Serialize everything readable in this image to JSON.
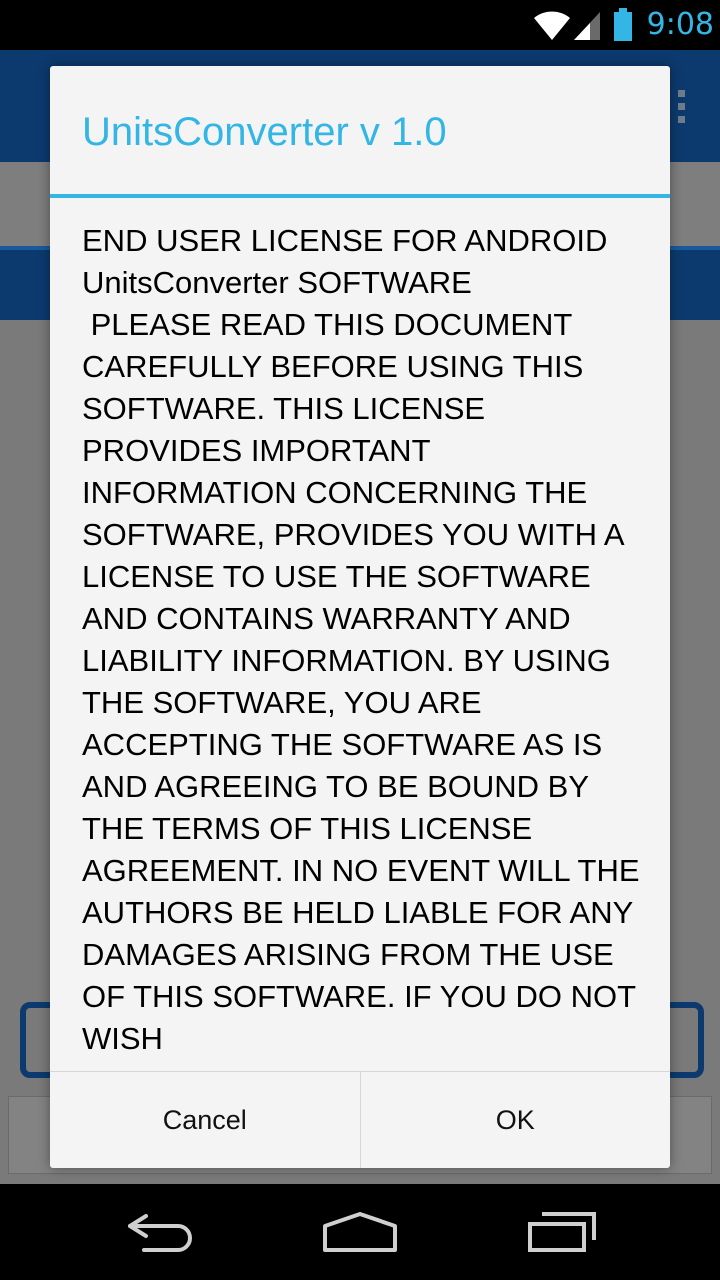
{
  "status_bar": {
    "time": "9:08",
    "icons": [
      "wifi-icon",
      "signal-icon",
      "battery-icon"
    ],
    "accent_color": "#33b5e5"
  },
  "dialog": {
    "title": "UnitsConverter v 1.0",
    "body_text": "END USER LICENSE FOR ANDROID UnitsConverter SOFTWARE\n PLEASE READ THIS DOCUMENT CAREFULLY BEFORE USING THIS SOFTWARE. THIS LICENSE PROVIDES IMPORTANT INFORMATION CONCERNING THE SOFTWARE, PROVIDES YOU WITH A LICENSE TO USE THE SOFTWARE AND CONTAINS WARRANTY AND LIABILITY INFORMATION. BY USING THE SOFTWARE, YOU ARE ACCEPTING THE SOFTWARE AS IS AND AGREEING TO BE BOUND BY THE TERMS OF THIS LICENSE AGREEMENT. IN NO EVENT WILL THE AUTHORS BE HELD LIABLE FOR ANY DAMAGES ARISING FROM THE USE OF THIS SOFTWARE. IF YOU DO NOT WISH",
    "cancel_label": "Cancel",
    "ok_label": "OK",
    "accent_color": "#33b5e5"
  },
  "background_app": {
    "actionbar_color": "#0c3a6e",
    "icons": [
      "overflow-menu-icon"
    ]
  },
  "nav_bar": {
    "icons": [
      "back-icon",
      "home-icon",
      "recent-apps-icon"
    ]
  }
}
